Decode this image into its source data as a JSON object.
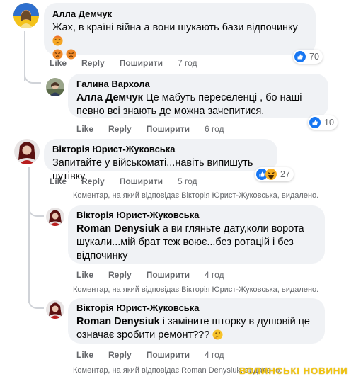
{
  "actions": {
    "like": "Like",
    "reply": "Reply",
    "share": "Поширити"
  },
  "comments": [
    {
      "author": "Алла Демчук",
      "text": "Жах, в країні війна а вони шукають бази відпочинку",
      "time": "7 год",
      "reactions": {
        "icons": [
          "like-icon"
        ],
        "count": "70"
      }
    },
    {
      "author": "Галина Вархола",
      "mention": "Алла Демчук",
      "text": "Це мабуть переселенці , бо наші певно всі знають де можна зачепитися.",
      "time": "6 год",
      "reactions": {
        "icons": [
          "like-icon"
        ],
        "count": "10"
      }
    },
    {
      "author": "Вікторія Юрист-Жуковська",
      "text": "Запитайте у військоматі...навіть випишуть путівку",
      "time": "5 год",
      "reactions": {
        "icons": [
          "like-icon",
          "haha-icon"
        ],
        "count": "27"
      }
    },
    {
      "author": "Вікторія Юрист-Жуковська",
      "mention": "Roman Denysiuk",
      "text": "а ви гляньте дату,коли ворота шукали...мій брат теж воює...без ротацій і без відпочинку",
      "time": "4 год"
    },
    {
      "author": "Вікторія Юрист-Жуковська",
      "mention": "Roman Denysiuk",
      "text": "і заміните шторку в душовій це означає зробити ремонт???",
      "time": "4 год"
    }
  ],
  "deleted_notices": [
    "Коментар, на який відповідає Вікторія Юрист-Жуковська, видалено.",
    "Коментар, на який відповідає Вікторія Юрист-Жуковська, видалено.",
    "Коментар, на який відповідає Roman Denysiuk, видалено."
  ],
  "watermark": "ВОЛИНСЬКІ НОВИНИ",
  "colors": {
    "like_blue": "#1877f2",
    "bubble": "#f0f2f5",
    "muted": "#65676b",
    "watermark": "#f2c511"
  }
}
